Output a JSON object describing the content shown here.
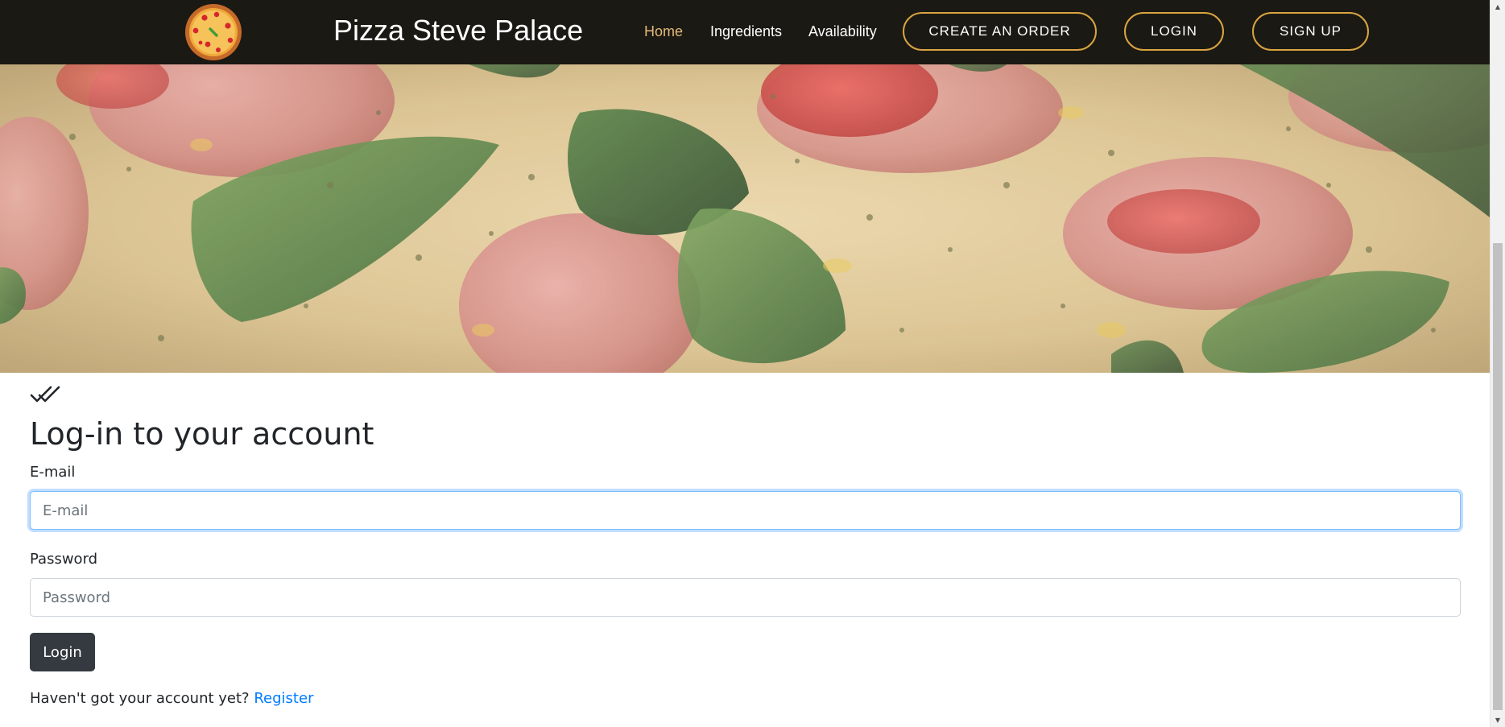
{
  "brand": {
    "name": "Pizza Steve Palace",
    "logo_icon": "pizza-icon"
  },
  "nav": {
    "links": [
      {
        "label": "Home",
        "active": true
      },
      {
        "label": "Ingredients",
        "active": false
      },
      {
        "label": "Availability",
        "active": false
      }
    ],
    "buttons": {
      "create_order": "CREATE AN ORDER",
      "login": "LOGIN",
      "sign_up": "SIGN UP"
    }
  },
  "hero": {
    "image": "pizza-closeup-background"
  },
  "login_form": {
    "check_icon": "double-check-icon",
    "title": "Log-in to your account",
    "email": {
      "label": "E-mail",
      "placeholder": "E-mail",
      "value": ""
    },
    "password": {
      "label": "Password",
      "placeholder": "Password",
      "value": ""
    },
    "submit_label": "Login",
    "register_prompt": "Haven't got your account yet?",
    "register_link": "Register"
  },
  "colors": {
    "navbar_bg": "#1b1913",
    "nav_active": "#e4b97a",
    "button_border": "#d9a441",
    "login_button_bg": "#343a40",
    "link": "#007bff",
    "focus_border": "#80bdff"
  }
}
